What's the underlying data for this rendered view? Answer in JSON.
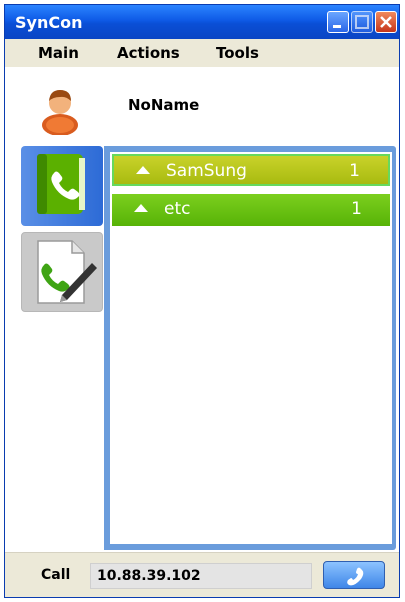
{
  "window": {
    "title": "SynCon"
  },
  "menu": {
    "items": [
      "Main",
      "Actions",
      "Tools"
    ]
  },
  "profile": {
    "name": "NoName",
    "icon": "user-avatar-icon"
  },
  "side_tabs": [
    {
      "icon": "phonebook-icon",
      "active": true
    },
    {
      "icon": "call-log-icon",
      "active": false
    }
  ],
  "groups": [
    {
      "name": "SamSung",
      "count": "1",
      "selected": true
    },
    {
      "name": "etc",
      "count": "1",
      "selected": false
    }
  ],
  "call": {
    "label": "Call",
    "value": "10.88.39.102"
  },
  "colors": {
    "title_bar": "#0e5ae6",
    "group_selected": "#b6c41c",
    "group_normal": "#69c015",
    "list_frame": "#6a9cdc"
  }
}
